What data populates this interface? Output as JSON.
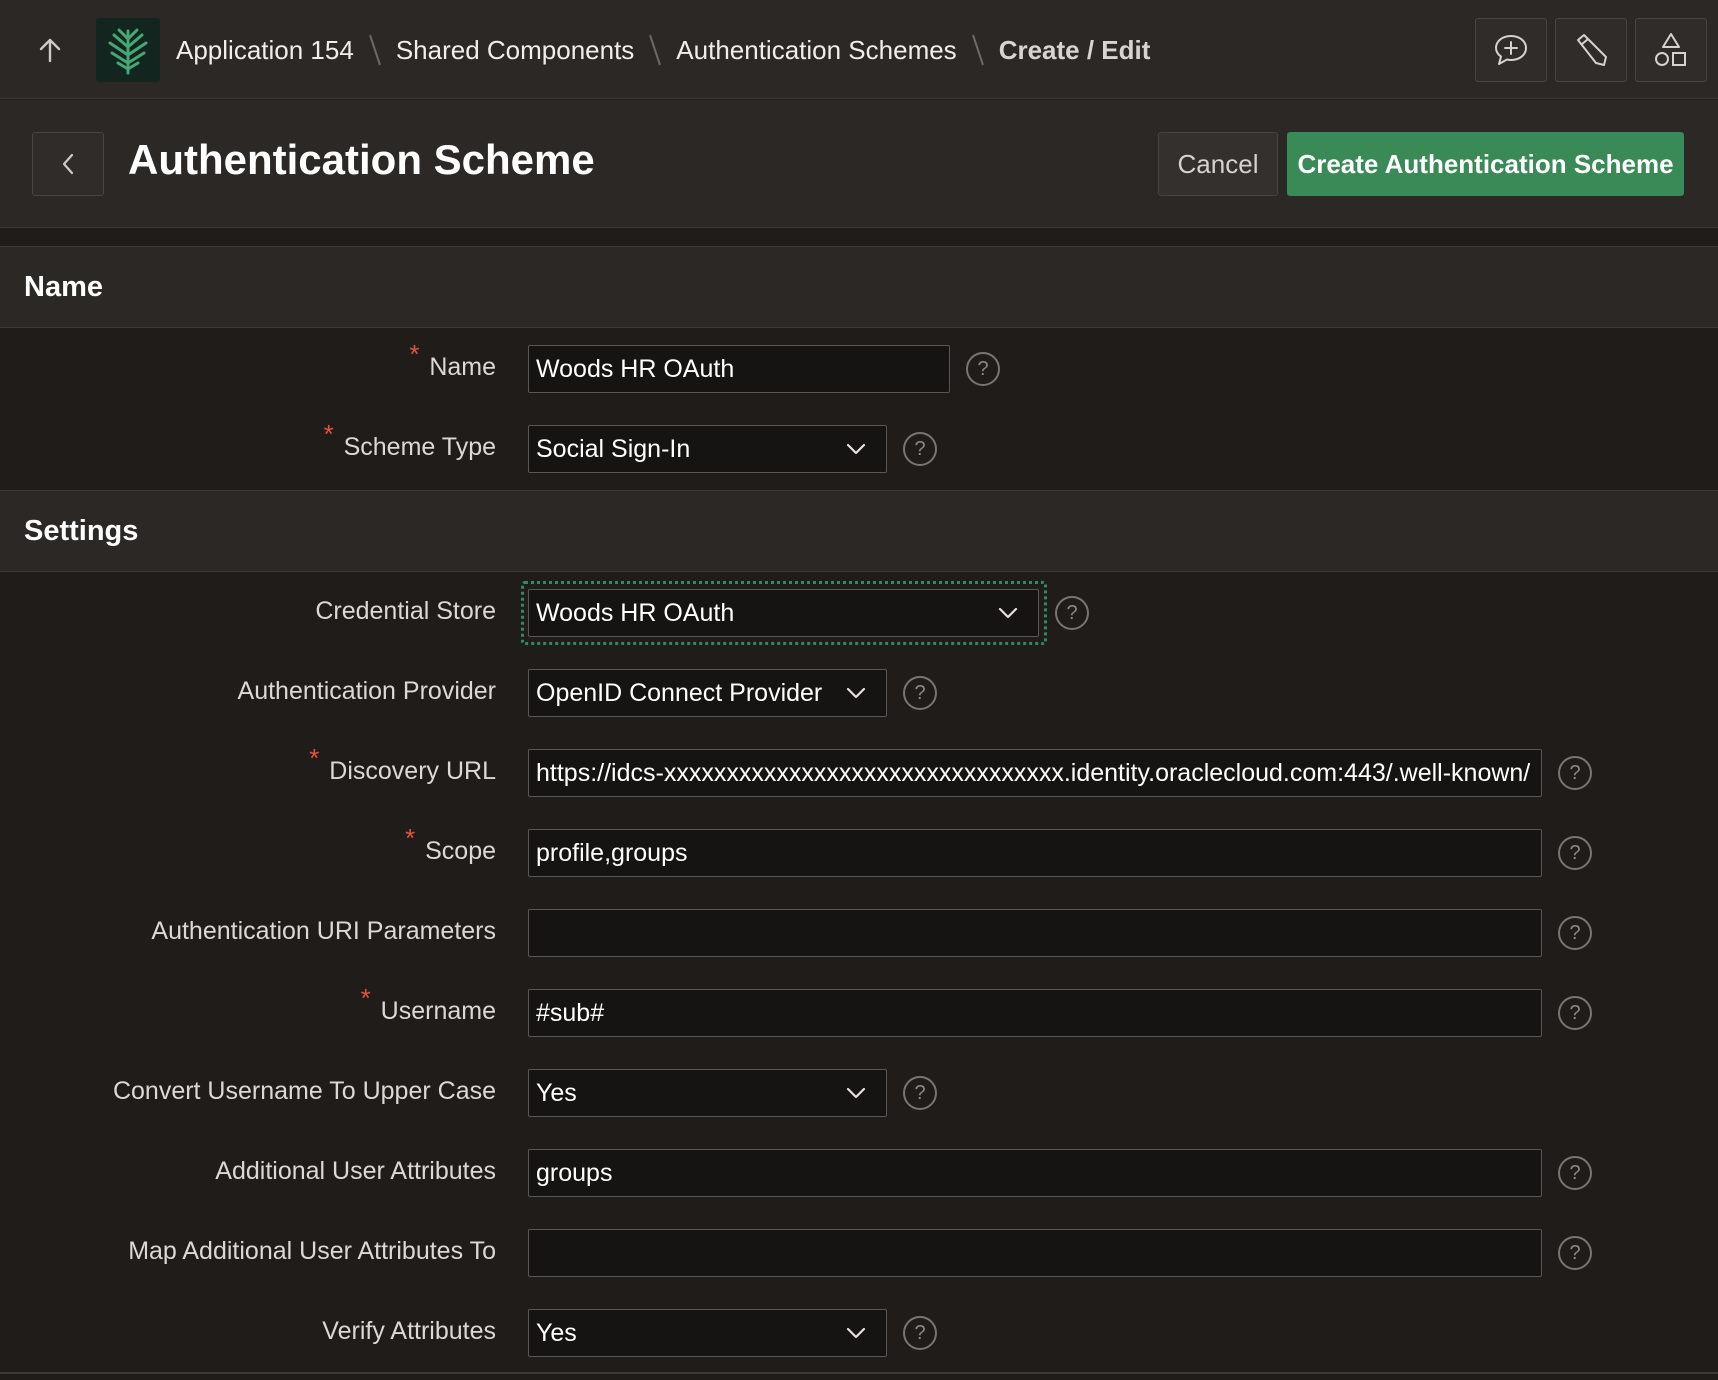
{
  "topbar": {
    "breadcrumb": [
      {
        "label": "Application 154"
      },
      {
        "label": "Shared Components"
      },
      {
        "label": "Authentication Schemes"
      },
      {
        "label": "Create / Edit"
      }
    ],
    "tools": [
      {
        "name": "comment-plus-icon"
      },
      {
        "name": "pencil-tag-icon"
      },
      {
        "name": "shapes-icon"
      }
    ]
  },
  "header": {
    "title": "Authentication Scheme",
    "cancel_label": "Cancel",
    "create_label": "Create Authentication Scheme"
  },
  "colors": {
    "primary_button": "#3a8a57",
    "required": "#e3533e",
    "focus": "#2f8a66"
  },
  "sections": {
    "name": {
      "title": "Name",
      "fields": [
        {
          "label": "Name",
          "value": "Woods HR OAuth",
          "required": true,
          "type": "text"
        },
        {
          "label": "Scheme Type",
          "value": "Social Sign-In",
          "required": true,
          "type": "select"
        }
      ]
    },
    "settings": {
      "title": "Settings",
      "fields": [
        {
          "label": "Credential Store",
          "value": "Woods HR OAuth",
          "required": false,
          "type": "select"
        },
        {
          "label": "Authentication Provider",
          "value": "OpenID Connect Provider",
          "required": false,
          "type": "select"
        },
        {
          "label": "Discovery URL",
          "value": "https://idcs-xxxxxxxxxxxxxxxxxxxxxxxxxxxxxxxx.identity.oraclecloud.com:443/.well-known/",
          "required": true,
          "type": "text"
        },
        {
          "label": "Scope",
          "value": "profile,groups",
          "required": true,
          "type": "text"
        },
        {
          "label": "Authentication URI Parameters",
          "value": "",
          "required": false,
          "type": "text"
        },
        {
          "label": "Username",
          "value": "#sub#",
          "required": true,
          "type": "text"
        },
        {
          "label": "Convert Username To Upper Case",
          "value": "Yes",
          "required": false,
          "type": "select"
        },
        {
          "label": "Additional User Attributes",
          "value": "groups",
          "required": false,
          "type": "text"
        },
        {
          "label": "Map Additional User Attributes To",
          "value": "",
          "required": false,
          "type": "text"
        },
        {
          "label": "Verify Attributes",
          "value": "Yes",
          "required": false,
          "type": "select"
        }
      ]
    }
  },
  "help_symbol": "?",
  "required_symbol": "*"
}
